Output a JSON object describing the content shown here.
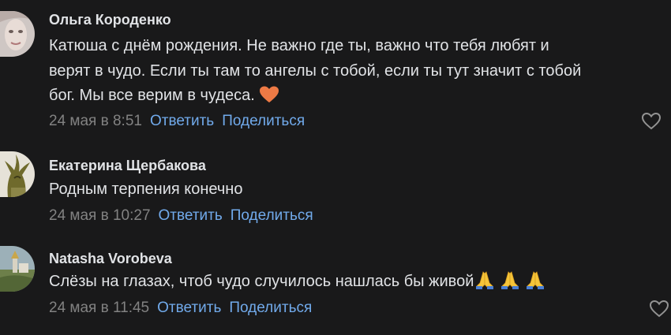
{
  "comments": [
    {
      "author": "Ольга Короденко",
      "lines": [
        "Катюша с днём рождения. Не важно где ты, важно что тебя любят и",
        "верят в чудо. Если ты там то ангелы с тобой, если ты тут значит с тобой",
        "бог. Мы все верим в чудеса. "
      ],
      "emoji": "orange-heart-icon",
      "date": "24 мая в 8:51",
      "reply_label": "Ответить",
      "share_label": "Поделиться"
    },
    {
      "author": "Екатерина Щербакова",
      "lines": [
        "Родным терпения конечно"
      ],
      "date": "24 мая в 10:27",
      "reply_label": "Ответить",
      "share_label": "Поделиться"
    },
    {
      "author": "Natasha Vorobeva",
      "lines": [
        "Слёзы на глазах, чтоб чудо случилось нашлась бы живой"
      ],
      "emoji": "folded-hands-icon",
      "date": "24 мая в 11:45",
      "reply_label": "Ответить",
      "share_label": "Поделиться"
    }
  ],
  "colors": {
    "background": "#19191a",
    "text": "#e1e3e6",
    "secondary": "#828282",
    "link": "#71aaeb",
    "heart": "#ee7a45"
  }
}
